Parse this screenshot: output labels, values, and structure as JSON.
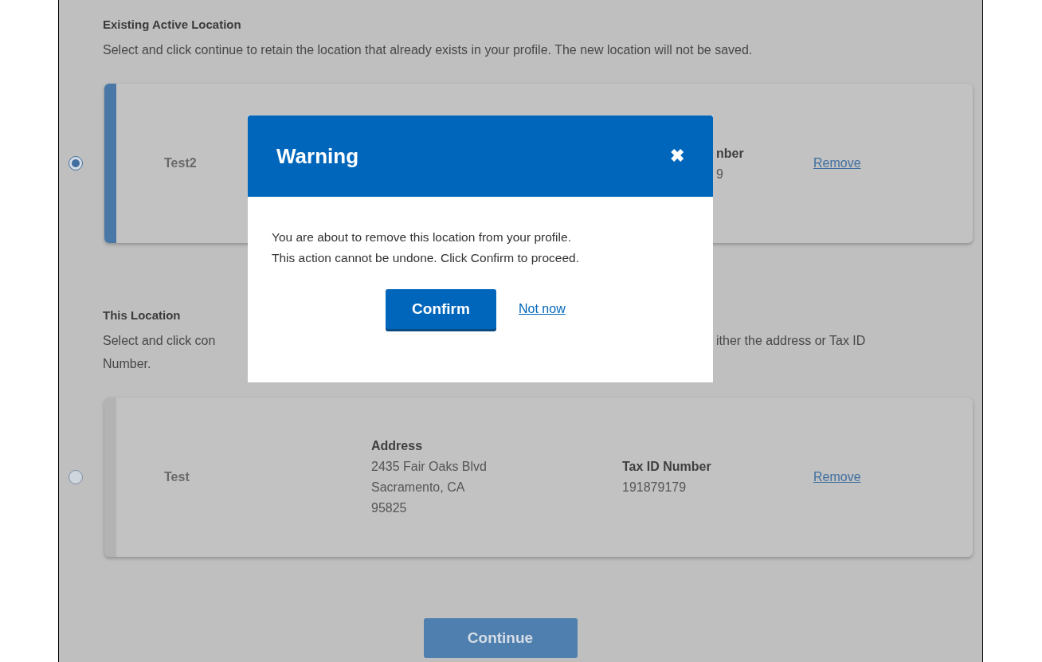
{
  "sections": [
    {
      "title": "Existing Active Location",
      "description_lines": [
        [
          "Select and click continue to retain the location that already exists in your profile. The new location will not be saved."
        ]
      ],
      "card": {
        "selected": true,
        "name": "Test2",
        "tax": {
          "obscured": true,
          "heading": "nber",
          "lines": [
            "9"
          ]
        },
        "remove": "Remove"
      }
    },
    {
      "title": "This Location",
      "description_lines": [
        [
          "Select and click con",
          "ither the address or Tax ID"
        ],
        [
          "Number."
        ]
      ],
      "card": {
        "selected": false,
        "name": "Test",
        "address": {
          "heading": "Address",
          "lines": [
            "2435 Fair Oaks Blvd",
            "Sacramento, CA",
            "95825"
          ]
        },
        "tax": {
          "obscured": false,
          "heading": "Tax ID Number",
          "lines": [
            "191879179"
          ]
        },
        "remove": "Remove"
      }
    }
  ],
  "continue_button": "Continue",
  "modal": {
    "title": "Warning",
    "close": "✖",
    "message_lines": [
      "You are about to remove this location from your profile.",
      "This action cannot be undone. Click Confirm to proceed."
    ],
    "confirm": "Confirm",
    "dismiss": "Not now"
  }
}
